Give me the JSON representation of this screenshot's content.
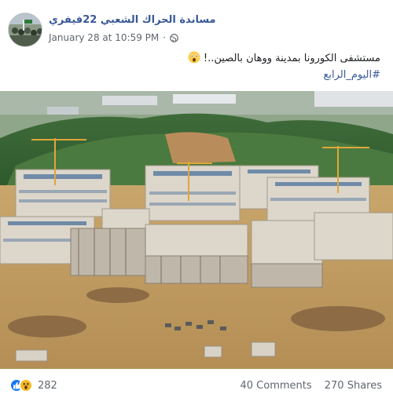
{
  "post": {
    "page_name": "مساندة الحراك الشعبي 22فيفري",
    "timestamp": "January 28 at 10:59 PM",
    "separator": "·",
    "privacy_icon": "globe-icon",
    "text_line1": "مستشفى الكورونا بمدينة ووهان بالصين..!",
    "text_emoji": "astonished-face-emoji",
    "hashtag": "#اليوم_الرابع",
    "image_description_icon": "construction-site-photo"
  },
  "footer": {
    "reaction_icons": [
      "like-icon",
      "wow-icon"
    ],
    "reaction_count": "282",
    "comments": "40 Comments",
    "shares": "270 Shares"
  },
  "colors": {
    "link_blue": "#385898",
    "like_blue": "#1877f2",
    "wow_yellow": "#f7b928",
    "meta_gray": "#606770"
  }
}
